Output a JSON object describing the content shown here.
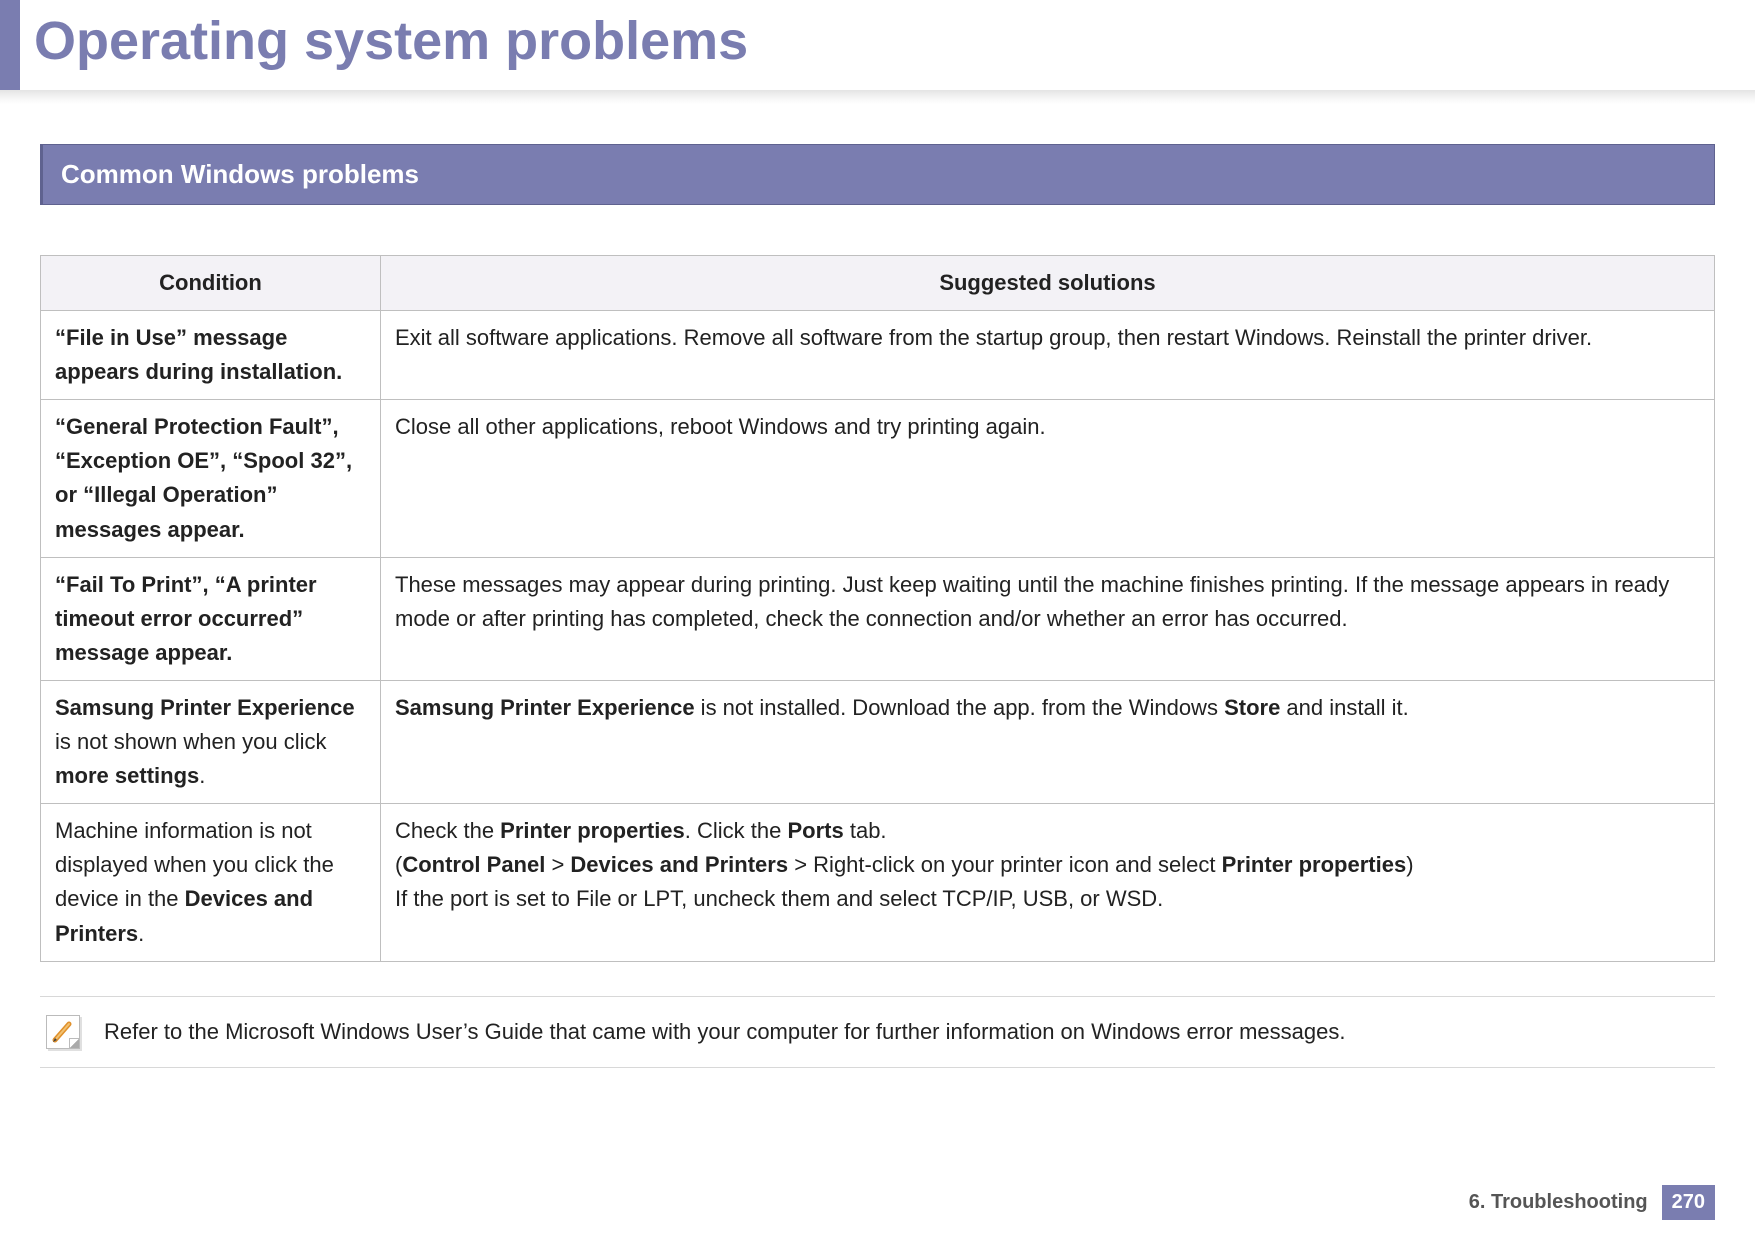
{
  "page_title": "Operating system problems",
  "section_title": "Common Windows problems",
  "table": {
    "headers": {
      "condition": "Condition",
      "solutions": "Suggested solutions"
    },
    "rows": [
      {
        "condition_html": "<span class='cond-bold'>“File in Use” message appears during installation.</span>",
        "solution_html": "Exit all software applications. Remove all software from the startup group, then restart Windows. Reinstall the printer driver."
      },
      {
        "condition_html": "<span class='cond-bold'>“General Protection Fault”, “Exception OE”, “Spool 32”, or “Illegal Operation” messages appear.</span>",
        "solution_html": "Close all other applications, reboot Windows and try printing again."
      },
      {
        "condition_html": "<span class='cond-bold'>“Fail To Print”, “A printer timeout error occurred” message appear.</span>",
        "solution_html": "These messages may appear during printing. Just keep waiting until the machine finishes printing. If the message appears in ready mode or after printing has completed, check the connection and/or whether an error has occurred."
      },
      {
        "condition_html": "<b>Samsung Printer Experience</b> is not shown when you click <b>more settings</b>.",
        "solution_html": "<b>Samsung Printer Experience</b> is not installed. Download the app. from the Windows <b>Store</b> and install it."
      },
      {
        "condition_html": "Machine information is not displayed when you click the device in the <b>Devices and Printers</b>.",
        "solution_html": "Check the <b>Printer properties</b>. Click the <b>Ports</b> tab.<br>(<b>Control Panel</b> &gt; <b>Devices and Printers</b> &gt; Right-click on your printer icon and select <b>Printer properties</b>)<br>If the port is set to File or LPT, uncheck them and select TCP/IP, USB, or WSD."
      }
    ]
  },
  "note": "Refer to the Microsoft Windows User’s Guide that came with your computer for further information on Windows error messages.",
  "footer": {
    "chapter": "6.  Troubleshooting",
    "page": "270"
  }
}
